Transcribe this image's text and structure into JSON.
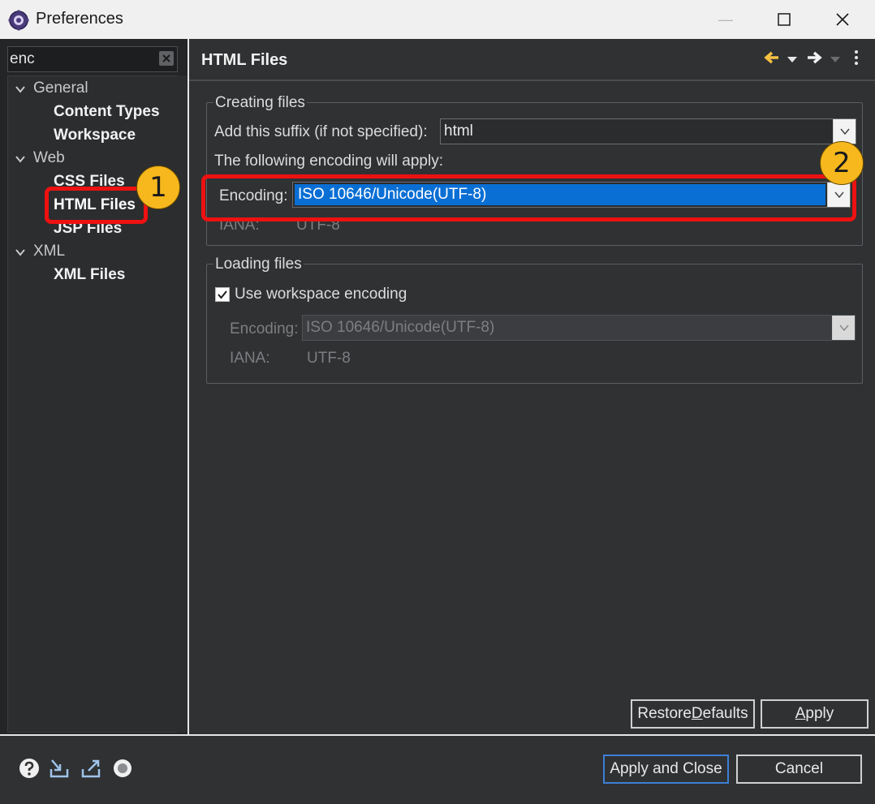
{
  "window": {
    "title": "Preferences",
    "minimize_glyph": "—",
    "maximize_glyph": "☐",
    "close_glyph": "✕"
  },
  "filter": {
    "value": "enc"
  },
  "tree": {
    "general": {
      "label": "General",
      "children": [
        "Content Types",
        "Workspace"
      ]
    },
    "web": {
      "label": "Web",
      "children": [
        "CSS Files",
        "HTML Files",
        "JSP Files"
      ]
    },
    "xml": {
      "label": "XML",
      "children": [
        "XML Files"
      ]
    },
    "selected": "HTML Files"
  },
  "page": {
    "title": "HTML Files",
    "creating": {
      "legend": "Creating files",
      "suffix_label": "Add this suffix (if not specified):",
      "suffix_value": "html",
      "encoding_note": "The following encoding will apply:",
      "encoding_label": "Encoding:",
      "encoding_value": "ISO 10646/Unicode(UTF-8)",
      "iana_label": "IANA:",
      "iana_value": "UTF-8"
    },
    "loading": {
      "legend": "Loading files",
      "use_workspace_label": "Use workspace encoding",
      "use_workspace_checked": true,
      "encoding_label": "Encoding:",
      "encoding_value": "ISO 10646/Unicode(UTF-8)",
      "iana_label": "IANA:",
      "iana_value": "UTF-8"
    }
  },
  "buttons": {
    "restore_pre": "Restore ",
    "restore_u": "D",
    "restore_post": "efaults",
    "apply_u": "A",
    "apply_post": "pply",
    "apply_close": "Apply and Close",
    "cancel": "Cancel"
  },
  "annotations": {
    "badge1": "1",
    "badge2": "2"
  },
  "colors": {
    "accent": "#0a6fd4",
    "highlight_red": "#ee1111",
    "badge_yellow": "#f7b81d",
    "background": "#2f3133"
  },
  "icons": [
    "preferences-app-icon",
    "help-icon",
    "import-icon",
    "export-icon",
    "record-icon",
    "back-arrow-icon",
    "forward-arrow-icon",
    "more-menu-icon"
  ]
}
